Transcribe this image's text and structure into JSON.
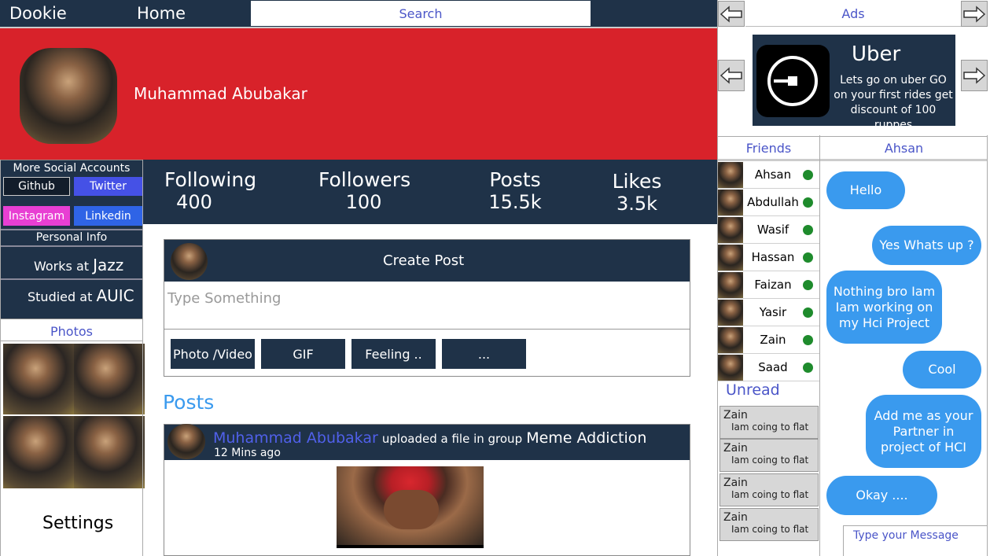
{
  "header": {
    "brand": "Dookie",
    "home": "Home",
    "search_placeholder": "Search"
  },
  "ads": {
    "title": "Ads",
    "uber_title": "Uber",
    "uber_text": "Lets go on uber GO on your first rides get discount of 100 ruppes"
  },
  "profile": {
    "name": "Muhammad Abubakar",
    "banner_color": "#d8222a"
  },
  "social": {
    "title": "More Social Accounts",
    "github": "Github",
    "twitter": "Twitter",
    "instagram": "Instagram",
    "linkedin": "Linkedin"
  },
  "personal": {
    "title": "Personal Info",
    "works_prefix": "Works at",
    "works_value": "Jazz",
    "studied_prefix": "Studied at",
    "studied_value": "AUIC"
  },
  "photos": {
    "title": "Photos"
  },
  "settings": "Settings",
  "stats": [
    {
      "label": "Following",
      "value": "400"
    },
    {
      "label": "Followers",
      "value": "100"
    },
    {
      "label": "Posts",
      "value": "15.5k"
    },
    {
      "label": "Likes",
      "value": "3.5k"
    }
  ],
  "create_post": {
    "title": "Create Post",
    "placeholder": "Type Something",
    "buttons": [
      "Photo /Video",
      "GIF",
      "Feeling ..",
      "..."
    ]
  },
  "posts": {
    "heading": "Posts",
    "author": "Muhammad Abubakar",
    "action": "uploaded a file in group",
    "group": "Meme Addiction",
    "time": "12 Mins ago"
  },
  "friends": {
    "title": "Friends",
    "list": [
      "Ahsan",
      "Abdullah",
      "Wasif",
      "Hassan",
      "Faizan",
      "Yasir",
      "Zain",
      "Saad"
    ]
  },
  "unread": {
    "title": "Unread",
    "items": [
      {
        "name": "Zain",
        "text": "Iam coing to flat"
      },
      {
        "name": "Zain",
        "text": "Iam coing to flat"
      },
      {
        "name": "Zain",
        "text": "Iam coing to flat"
      },
      {
        "name": "Zain",
        "text": "Iam coing to flat"
      }
    ]
  },
  "chat": {
    "title": "Ahsan",
    "messages": [
      "Hello",
      "Yes Whats  up ?",
      "Nothing bro Iam Iam working on my Hci Project",
      "Cool",
      "Add me as your Partner in project of HCI",
      "Okay ...."
    ],
    "input_placeholder": "Type your Message"
  }
}
